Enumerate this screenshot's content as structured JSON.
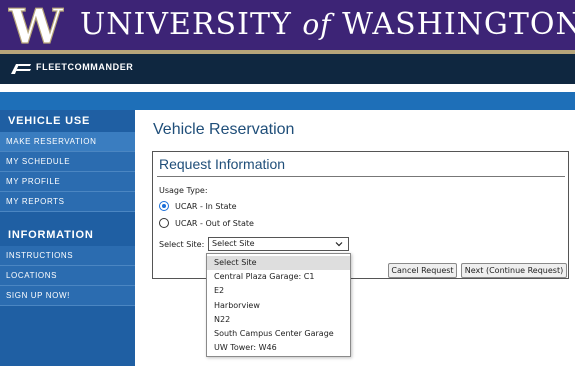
{
  "header": {
    "logo_letter": "W",
    "title_part1": "UNIVERSITY",
    "title_of": "of",
    "title_part2": "WASHINGTON",
    "colors": {
      "purple": "#3d2476",
      "gold": "#b7a57a"
    }
  },
  "fleet_bar": {
    "brand": "FLEETCOMMANDER",
    "icon": "fleetcommander-logo-icon"
  },
  "sidebar": {
    "section1_title": "VEHICLE USE",
    "section1_items": [
      {
        "label": "MAKE RESERVATION",
        "active": true
      },
      {
        "label": "MY SCHEDULE"
      },
      {
        "label": "MY PROFILE"
      },
      {
        "label": "MY REPORTS"
      }
    ],
    "section2_title": "INFORMATION",
    "section2_items": [
      {
        "label": "INSTRUCTIONS"
      },
      {
        "label": "LOCATIONS"
      },
      {
        "label": "SIGN UP NOW!"
      }
    ]
  },
  "main": {
    "page_title": "Vehicle Reservation",
    "panel_title": "Request Information",
    "usage_label": "Usage Type:",
    "usage_options": [
      {
        "label": "UCAR - In State",
        "checked": true
      },
      {
        "label": "UCAR - Out of State",
        "checked": false
      }
    ],
    "site_label": "Select Site:",
    "site_selected": "Select Site",
    "site_options": [
      "Select Site",
      "Central Plaza Garage: C1",
      "E2",
      "Harborview",
      "N22",
      "South Campus Center Garage",
      "UW Tower: W46"
    ],
    "cancel_label": "Cancel Request",
    "next_label": "Next (Continue Request)"
  }
}
